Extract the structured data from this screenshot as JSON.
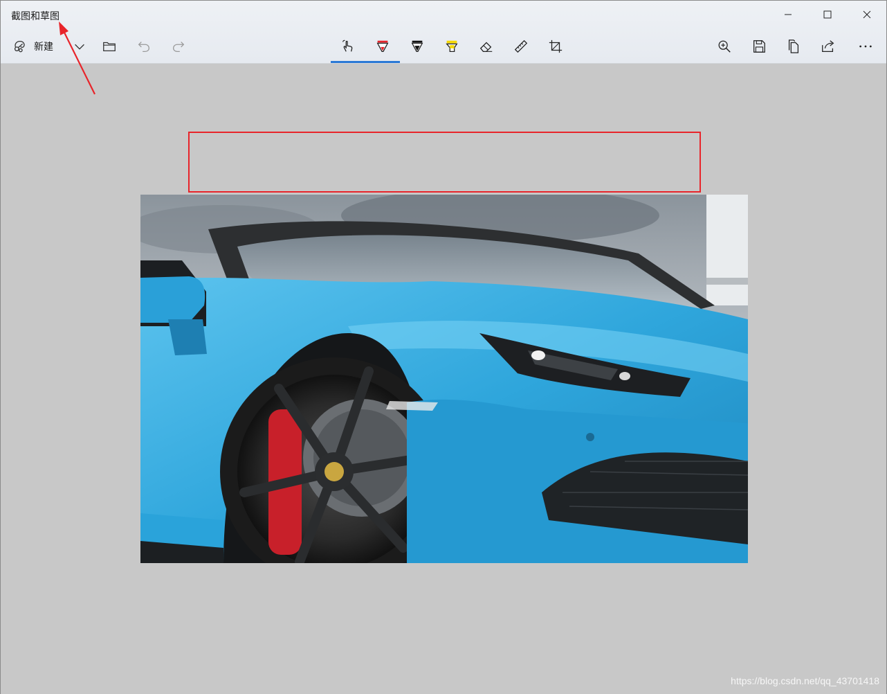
{
  "window": {
    "title": "截图和草图",
    "controls": {
      "minimize": "minimize-icon",
      "maximize": "maximize-icon",
      "close": "close-icon"
    }
  },
  "toolbar": {
    "new_label": "新建",
    "left_icons": [
      "new-snip-icon",
      "chevron-down-icon",
      "open-folder-icon",
      "undo-icon",
      "redo-icon"
    ],
    "center_tools": [
      "touch-writing-icon",
      "ballpoint-pen-icon",
      "pencil-icon",
      "highlighter-icon",
      "eraser-icon",
      "ruler-icon",
      "crop-icon"
    ],
    "active_tool": "touch-writing-icon",
    "right_icons": [
      "zoom-in-icon",
      "save-icon",
      "copy-icon",
      "share-icon",
      "more-icon"
    ],
    "accent_color": "#2b79d6",
    "pen_colors": {
      "ballpoint": "#e8242a",
      "pencil": "#111111",
      "highlighter": "#f5d800"
    }
  },
  "canvas": {
    "background": "#c8c8c8",
    "annotation_color": "#e8242a",
    "image": "blue-sports-car-photo"
  },
  "watermark": "https://blog.csdn.net/qq_43701418"
}
